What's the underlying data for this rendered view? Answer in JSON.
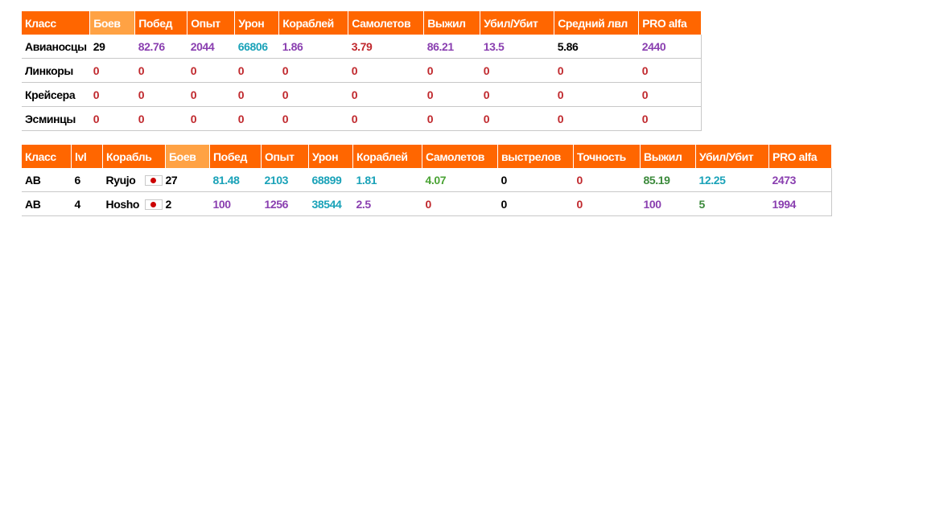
{
  "class_table": {
    "headers": [
      "Класс",
      "Боев",
      "Побед",
      "Опыт",
      "Урон",
      "Кораблей",
      "Самолетов",
      "Выжил",
      "Убил/Убит",
      "Средний лвл",
      "PRO alfa"
    ],
    "rows": [
      {
        "cells": [
          "Авианосцы",
          "29",
          "82.76",
          "2044",
          "66806",
          "1.86",
          "3.79",
          "86.21",
          "13.5",
          "5.86",
          "2440"
        ]
      },
      {
        "cells": [
          "Линкоры",
          "0",
          "0",
          "0",
          "0",
          "0",
          "0",
          "0",
          "0",
          "0",
          "0"
        ]
      },
      {
        "cells": [
          "Крейсера",
          "0",
          "0",
          "0",
          "0",
          "0",
          "0",
          "0",
          "0",
          "0",
          "0"
        ]
      },
      {
        "cells": [
          "Эсминцы",
          "0",
          "0",
          "0",
          "0",
          "0",
          "0",
          "0",
          "0",
          "0",
          "0"
        ]
      }
    ]
  },
  "ship_table": {
    "headers": [
      "Класс",
      "lvl",
      "Корабль",
      "Боев",
      "Побед",
      "Опыт",
      "Урон",
      "Кораблей",
      "Самолетов",
      "выстрелов",
      "Точность",
      "Выжил",
      "Убил/Убит",
      "PRO alfa"
    ],
    "rows": [
      {
        "cls": "АВ",
        "lvl": "6",
        "ship": "Ryujo",
        "flag_icon": "japan-flag-icon",
        "battles": "27",
        "cells": [
          "81.48",
          "2103",
          "68899",
          "1.81",
          "4.07",
          "0",
          "0",
          "85.19",
          "12.25",
          "2473"
        ]
      },
      {
        "cls": "АВ",
        "lvl": "4",
        "ship": "Hosho",
        "flag_icon": "japan-flag-icon",
        "battles": "2",
        "cells": [
          "100",
          "1256",
          "38544",
          "2.5",
          "0",
          "0",
          "0",
          "100",
          "5",
          "1994"
        ]
      }
    ]
  },
  "colors": {
    "header_bg": "#ff6600",
    "sorted_header_bg": "#ffa244",
    "red": "#c0282d",
    "purple": "#8a3fb0",
    "teal": "#1aa2b8",
    "green": "#4aa334"
  }
}
